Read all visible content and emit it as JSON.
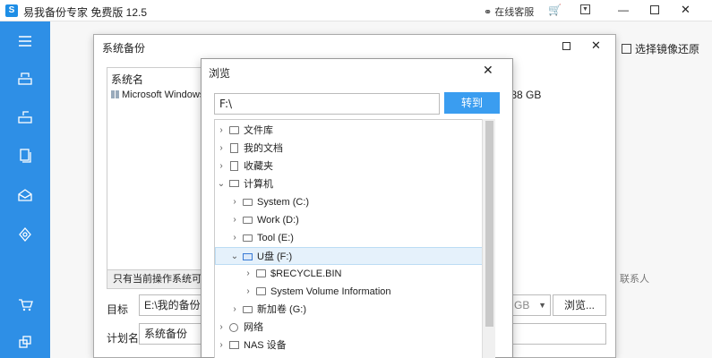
{
  "titlebar": {
    "logo": "S",
    "title": "易我备份专家 免费版 12.5",
    "service": "在线客服",
    "icons": {
      "service": "headset-icon",
      "cart": "cart-icon",
      "menu": "menu-icon",
      "minimize": "minimize-icon",
      "maximize": "maximize-icon",
      "close": "close-icon"
    }
  },
  "sidebar": {
    "accent": "#2e8fe6",
    "items": [
      "menu-icon",
      "disk-backup-icon",
      "disk-clone-icon",
      "files-icon",
      "mail-icon",
      "settings-icon",
      "cart-icon",
      "apps-icon"
    ]
  },
  "main": {
    "restore_link": "选择镜像还原",
    "contact_fragment": "联系人"
  },
  "backup_dialog": {
    "title": "系统备份",
    "list_header": "系统名",
    "list_row": "Microsoft Windows",
    "size_fragment": ".88 GB",
    "note": "只有当前操作系统可备份",
    "target_label": "目标",
    "target_value": "E:\\我的备份文",
    "gb_select": "GB",
    "browse_button": "浏览...",
    "plan_label": "计划名",
    "plan_value": "系统备份"
  },
  "browse_dialog": {
    "title": "浏览",
    "path_value": "F:\\",
    "goto_button": "转到",
    "accent": "#3a9df0",
    "tree": [
      {
        "label": "文件库",
        "icon": "folder-icon",
        "expanded": false
      },
      {
        "label": "我的文档",
        "icon": "document-icon",
        "expanded": false
      },
      {
        "label": "收藏夹",
        "icon": "favorites-icon",
        "expanded": false
      },
      {
        "label": "计算机",
        "icon": "computer-icon",
        "expanded": true
      },
      {
        "label": "System (C:)",
        "icon": "drive-icon",
        "expanded": false
      },
      {
        "label": "Work (D:)",
        "icon": "drive-icon",
        "expanded": false
      },
      {
        "label": "Tool (E:)",
        "icon": "drive-icon",
        "expanded": false
      },
      {
        "label": "U盘 (F:)",
        "icon": "usb-drive-icon",
        "expanded": true,
        "selected": true
      },
      {
        "label": "$RECYCLE.BIN",
        "icon": "folder-icon",
        "expanded": false
      },
      {
        "label": "System Volume Information",
        "icon": "folder-icon",
        "expanded": false
      },
      {
        "label": "新加卷 (G:)",
        "icon": "drive-icon",
        "expanded": false
      },
      {
        "label": "网络",
        "icon": "network-icon",
        "expanded": false
      },
      {
        "label": "NAS 设备",
        "icon": "nas-icon",
        "expanded": false
      }
    ]
  }
}
